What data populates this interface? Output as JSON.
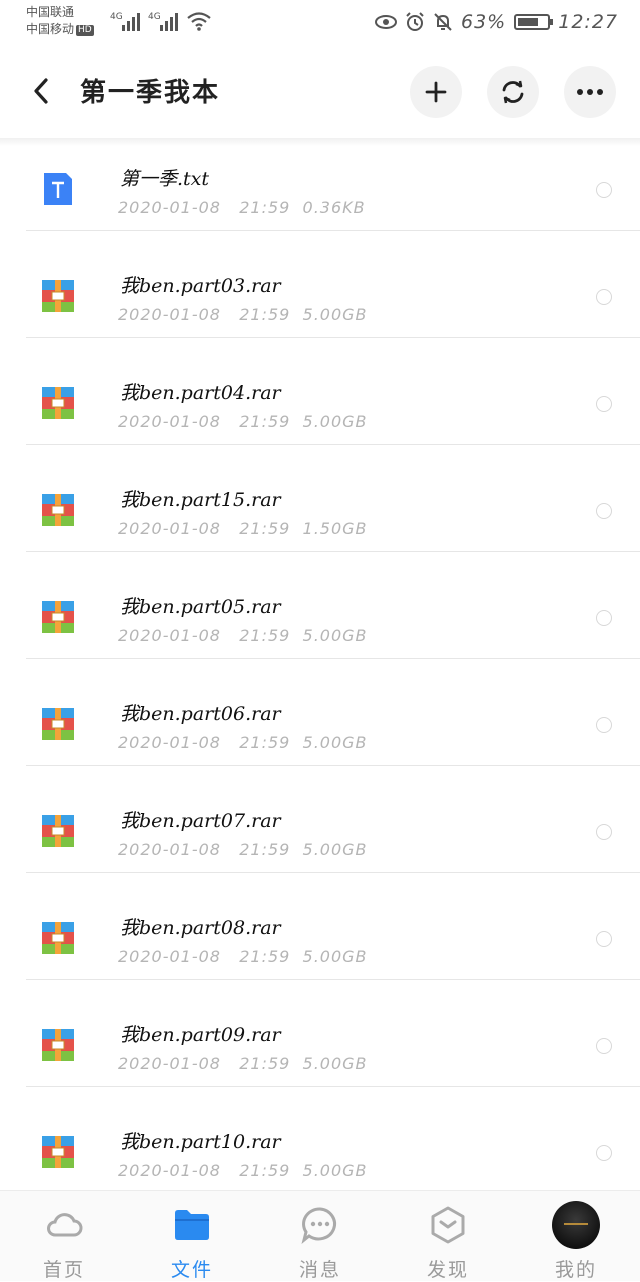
{
  "status": {
    "carrier1": "中国联通",
    "carrier2": "中国移动",
    "hd": "HD",
    "net1": "4G",
    "net2": "4G",
    "battery": "63%",
    "time": "12:27"
  },
  "header": {
    "title": "第一季我本"
  },
  "files": [
    {
      "name": "第一季.txt",
      "date": "2020-01-08",
      "time": "21:59",
      "size": "0.36KB",
      "type": "txt"
    },
    {
      "name": "我ben.part03.rar",
      "date": "2020-01-08",
      "time": "21:59",
      "size": "5.00GB",
      "type": "rar"
    },
    {
      "name": "我ben.part04.rar",
      "date": "2020-01-08",
      "time": "21:59",
      "size": "5.00GB",
      "type": "rar"
    },
    {
      "name": "我ben.part15.rar",
      "date": "2020-01-08",
      "time": "21:59",
      "size": "1.50GB",
      "type": "rar"
    },
    {
      "name": "我ben.part05.rar",
      "date": "2020-01-08",
      "time": "21:59",
      "size": "5.00GB",
      "type": "rar"
    },
    {
      "name": "我ben.part06.rar",
      "date": "2020-01-08",
      "time": "21:59",
      "size": "5.00GB",
      "type": "rar"
    },
    {
      "name": "我ben.part07.rar",
      "date": "2020-01-08",
      "time": "21:59",
      "size": "5.00GB",
      "type": "rar"
    },
    {
      "name": "我ben.part08.rar",
      "date": "2020-01-08",
      "time": "21:59",
      "size": "5.00GB",
      "type": "rar"
    },
    {
      "name": "我ben.part09.rar",
      "date": "2020-01-08",
      "time": "21:59",
      "size": "5.00GB",
      "type": "rar"
    },
    {
      "name": "我ben.part10.rar",
      "date": "2020-01-08",
      "time": "21:59",
      "size": "5.00GB",
      "type": "rar"
    }
  ],
  "tabs": [
    {
      "label": "首页",
      "icon": "cloud-icon",
      "active": false
    },
    {
      "label": "文件",
      "icon": "folder-icon",
      "active": true
    },
    {
      "label": "消息",
      "icon": "chat-icon",
      "active": false
    },
    {
      "label": "发现",
      "icon": "discover-icon",
      "active": false
    },
    {
      "label": "我的",
      "icon": "avatar",
      "active": false
    }
  ],
  "colors": {
    "accent": "#2a8af0",
    "txt_icon": "#3b82f6",
    "muted": "#b5b5b5"
  }
}
